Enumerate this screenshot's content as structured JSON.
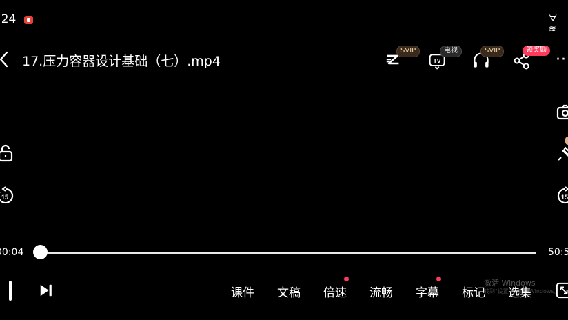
{
  "status_bar": {
    "time": ":24",
    "right_icons": "ᗊ ≋"
  },
  "header": {
    "title": "17.压力容器设计基础（七）.mp4"
  },
  "top_actions": {
    "svip_badge_1": "SVIP",
    "tv_badge": "电视",
    "svip_badge_2": "SVIP",
    "reward_badge": "领奖励",
    "more": "··"
  },
  "progress": {
    "current": "00:04",
    "total": "50:5",
    "fraction": 0.0
  },
  "bottom_menu": {
    "courseware": "课件",
    "transcript": "文稿",
    "speed": "倍速",
    "quality": "流畅",
    "subtitle": "字幕",
    "bookmark": "标记",
    "episodes": "选集"
  },
  "watermark": {
    "line1": "激活 Windows",
    "line2": "转到\"设置\"以激活 Windows。"
  },
  "colors": {
    "accent": "#ff3b5c",
    "record": "#e8403a"
  }
}
